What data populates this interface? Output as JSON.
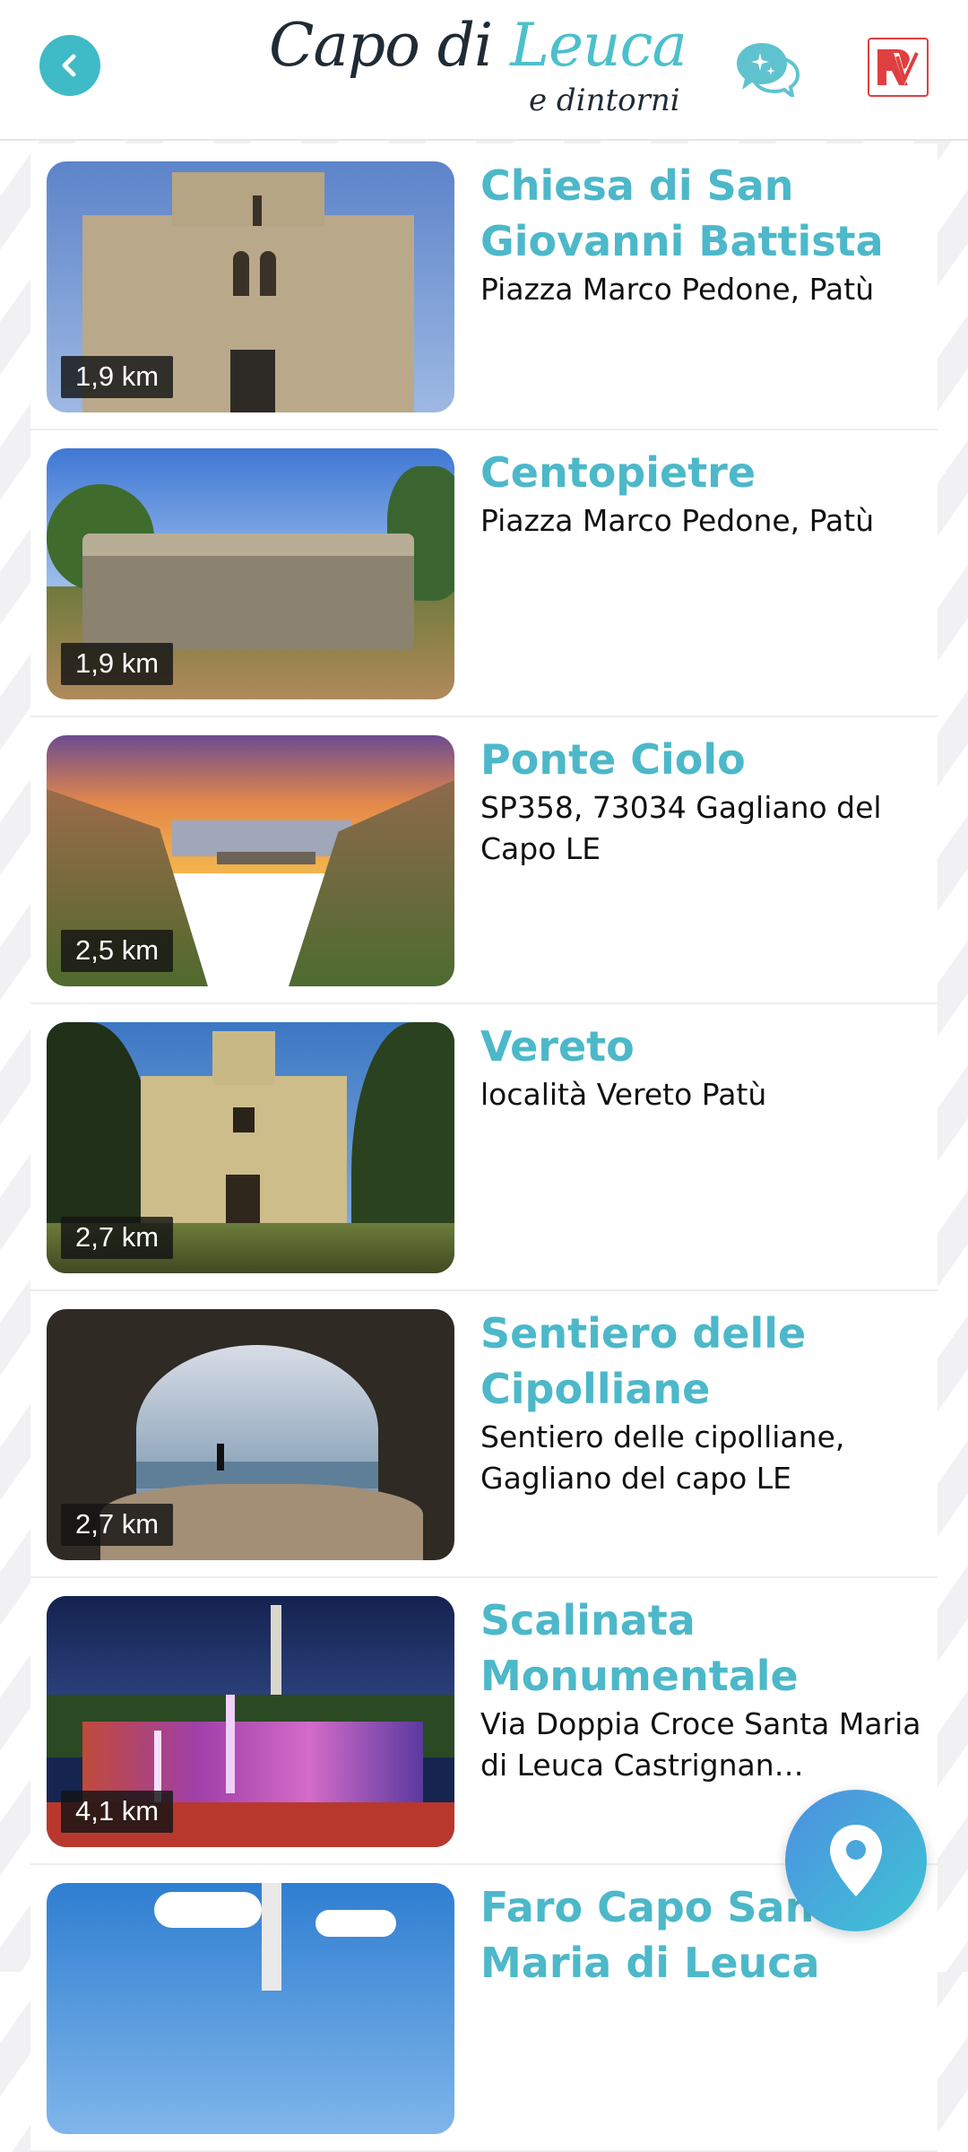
{
  "header": {
    "logo_part1": "Capo di ",
    "logo_part2": "Leuca",
    "logo_sub": "e dintorni"
  },
  "colors": {
    "accent": "#4cb8c9",
    "fab_start": "#4d8fe0",
    "fab_end": "#3fc5d4"
  },
  "places": [
    {
      "title": "Chiesa di San Giovanni Battista",
      "address": "Piazza Marco Pedone, Patù",
      "distance": "1,9 km"
    },
    {
      "title": "Centopietre",
      "address": "Piazza Marco Pedone, Patù",
      "distance": "1,9 km"
    },
    {
      "title": "Ponte Ciolo",
      "address": "SP358, 73034 Gagliano del Capo LE",
      "distance": "2,5 km"
    },
    {
      "title": "Vereto",
      "address": "località Vereto Patù",
      "distance": "2,7 km"
    },
    {
      "title": "Sentiero delle Cipolliane",
      "address": "Sentiero delle cipolliane, Gagliano del capo LE",
      "distance": "2,7 km"
    },
    {
      "title": "Scalinata Monumentale",
      "address": "Via Doppia Croce Santa Maria di Leuca Castrignan…",
      "distance": "4,1 km"
    },
    {
      "title": "Faro Capo Santa Maria di Leuca",
      "address": "",
      "distance": ""
    }
  ]
}
